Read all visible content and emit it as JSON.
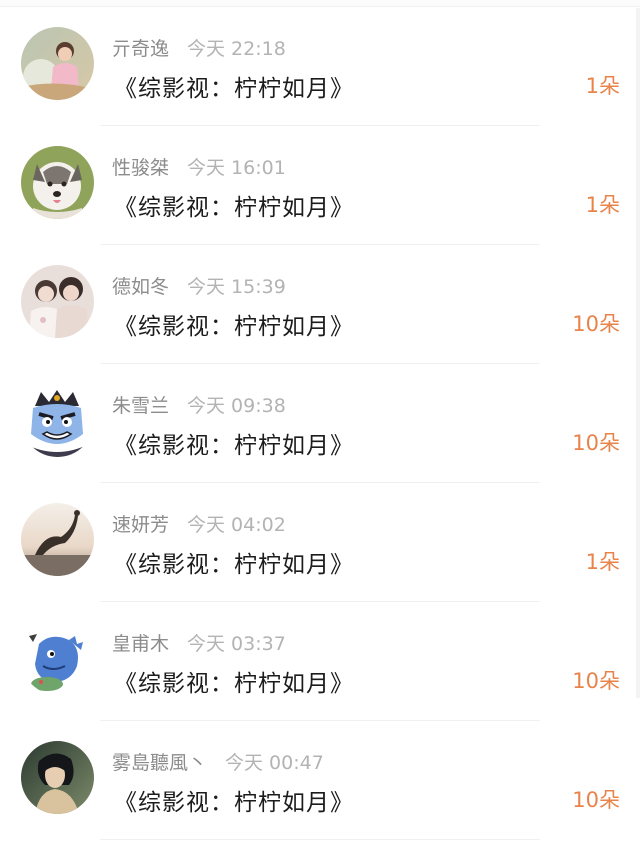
{
  "gift_records": [
    {
      "name": "亓奇逸",
      "time": "今天 22:18",
      "title": "《综影视：柠柠如月》",
      "amount": "1朵",
      "avatar_icon": "girl-photo-avatar"
    },
    {
      "name": "性骏桀",
      "time": "今天 16:01",
      "title": "《综影视：柠柠如月》",
      "amount": "1朵",
      "avatar_icon": "husky-dog-avatar"
    },
    {
      "name": "德如冬",
      "time": "今天 15:39",
      "title": "《综影视：柠柠如月》",
      "amount": "10朵",
      "avatar_icon": "two-girls-avatar"
    },
    {
      "name": "朱雪兰",
      "time": "今天 09:38",
      "title": "《综影视：柠柠如月》",
      "amount": "10朵",
      "avatar_icon": "cartoon-king-avatar"
    },
    {
      "name": "速妍芳",
      "time": "今天 04:02",
      "title": "《综影视：柠柠如月》",
      "amount": "1朵",
      "avatar_icon": "yoga-silhouette-avatar"
    },
    {
      "name": "皇甫木",
      "time": "今天 03:37",
      "title": "《综影视：柠柠如月》",
      "amount": "10朵",
      "avatar_icon": "blue-dinosaur-avatar"
    },
    {
      "name": "雾島聽風丶",
      "time": "今天 00:47",
      "title": "《综影视：柠柠如月》",
      "amount": "10朵",
      "avatar_icon": "portrait-photo-avatar"
    }
  ],
  "colors": {
    "amount": "#e8834a",
    "name": "#8c8c8c",
    "time": "#b3b3b3",
    "title": "#1c1c1c"
  }
}
